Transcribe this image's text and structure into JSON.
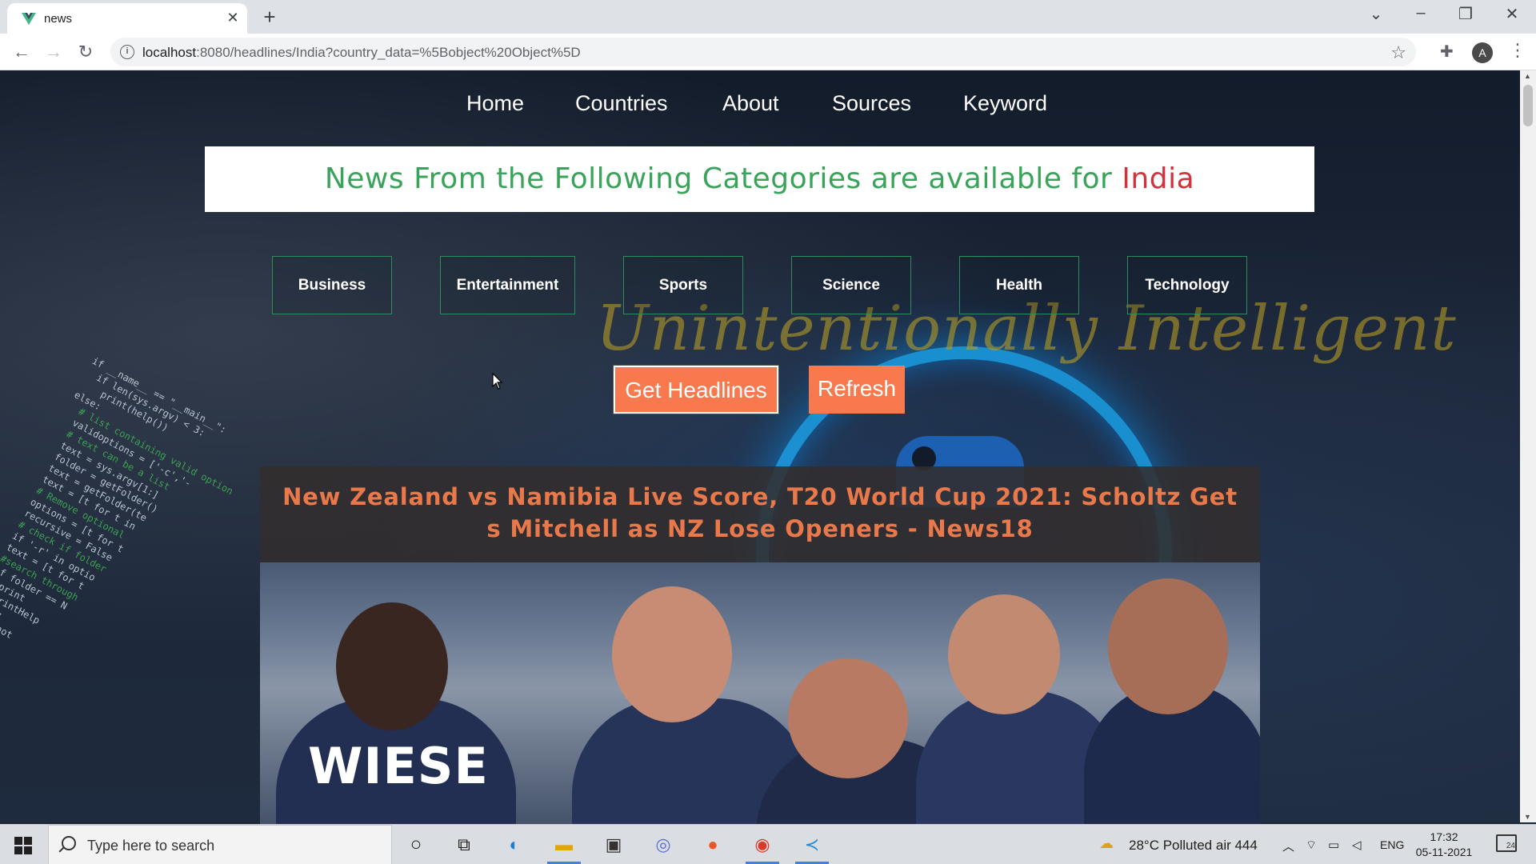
{
  "browser": {
    "tab_title": "news",
    "url_host": "localhost",
    "url_rest": ":8080/headlines/India?country_data=%5Bobject%20Object%5D",
    "profile_initial": "A"
  },
  "nav": {
    "items": [
      "Home",
      "Countries",
      "About",
      "Sources",
      "Keyword"
    ]
  },
  "banner": {
    "text": "News From the Following Categories are available for ",
    "country": "India"
  },
  "brand_deco": "Unintentionally Intelligent",
  "categories": [
    "Business",
    "Entertainment",
    "Sports",
    "Science",
    "Health",
    "Technology"
  ],
  "actions": {
    "get_headlines": "Get Headlines",
    "refresh": "Refresh"
  },
  "article": {
    "title": "New Zealand vs Namibia Live Score, T20 World Cup 2021: Scholtz Gets Mitchell as NZ Lose Openers - News18",
    "jersey_name": "WIESE"
  },
  "taskbar": {
    "search_placeholder": "Type here to search",
    "weather": "28°C  Polluted air 444",
    "language": "ENG",
    "time": "17:32",
    "date": "05-11-2021",
    "notifications": "24"
  },
  "colors": {
    "banner_green": "#3aa35a",
    "banner_red": "#d2323c",
    "accent_orange": "#f7794d",
    "category_border": "#2e8c5a"
  }
}
